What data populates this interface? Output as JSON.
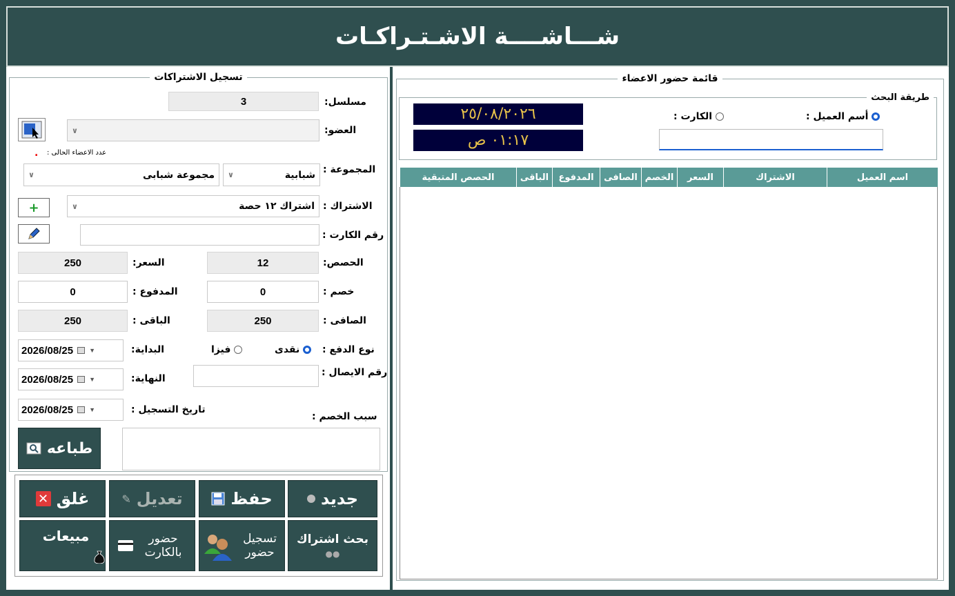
{
  "title": "شـــاشــــة الاشـتـراكـات",
  "registration": {
    "legend": "تسجيل الاشتراكات",
    "serial_label": "مسلسل:",
    "serial_value": "3",
    "member_label": "العضو:",
    "members_count_label": "عدد الاعضاء الحالى :",
    "members_count_value": ".",
    "group_label": "المجموعة :",
    "group_type": "شبابية",
    "group_name": "مجموعة شبابى",
    "subscription_label": "الاشتراك :",
    "subscription_value": "اشتراك ١٢ حصة",
    "card_label": "رقم الكارت :",
    "sessions_label": "الحصص:",
    "sessions_value": "12",
    "price_label": "السعر:",
    "price_value": "250",
    "discount_label": "خصم :",
    "discount_value": "0",
    "paid_label": "المدفوع :",
    "paid_value": "0",
    "net_label": "الصافى :",
    "net_value": "250",
    "remaining_label": "الباقى :",
    "remaining_value": "250",
    "payment_type_label": "نوع الدفع :",
    "payment_cash": "نقدى",
    "payment_visa": "فيزا",
    "start_label": "البداية:",
    "start_date": "2026/08/25",
    "receipt_label": "رقم الايصال :",
    "end_label": "النهاية:",
    "end_date": "2026/08/25",
    "reg_date_label": "تاريخ التسجيل :",
    "reg_date": "2026/08/25",
    "discount_reason_label": "سبب الخصم :",
    "print_label": "طباعه"
  },
  "buttons": {
    "new": "جديد",
    "save": "حفظ",
    "edit": "تعديل",
    "close": "غلق",
    "search_sub": "بحث اشتراك",
    "register_attendance": "تسجيل حضور",
    "card_attendance": "حضور بالكارت",
    "sales": "مبيعات"
  },
  "attendance": {
    "legend": "قائمة حضور الاعضاء",
    "search_legend": "طريقة البحث",
    "by_name": "أسم العميل :",
    "by_card": "الكارت :",
    "date": "٢٥/٠٨/٢٠٢٦",
    "time": "٠١:١٧ ص",
    "columns": [
      "اسم العميل",
      "الاشتراك",
      "السعر",
      "الخصم",
      "الصافى",
      "المدفوع",
      "الباقى",
      "الحصص المتبقية"
    ]
  },
  "colors": {
    "header_bg": "#2f4f4f",
    "grid_header": "#5a9b97",
    "lcd_bg": "#00003a",
    "lcd_text": "#e8c34a",
    "radio_on": "#1a5fd0"
  }
}
